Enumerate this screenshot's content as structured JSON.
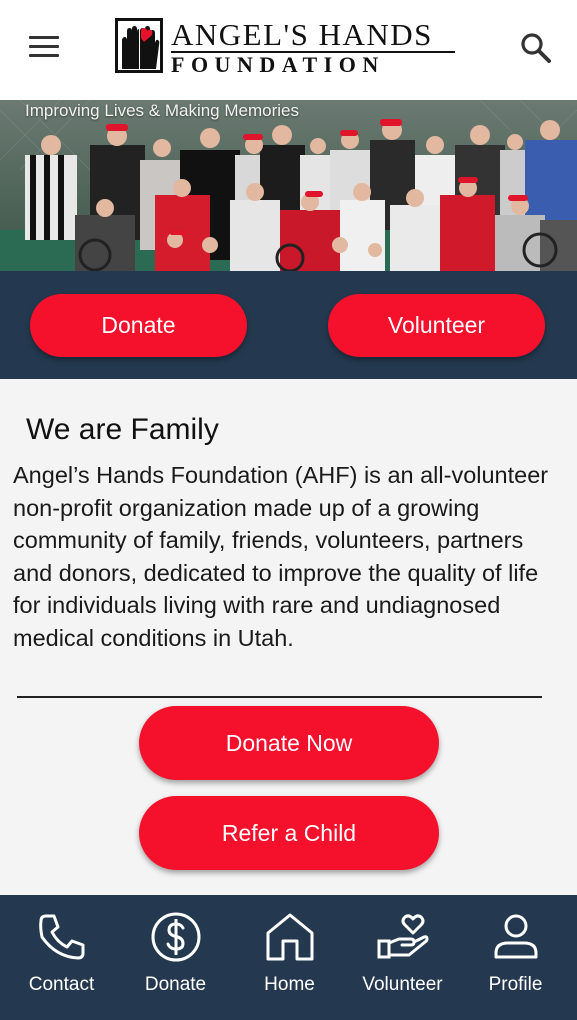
{
  "header": {
    "logo_line1": "ANGEL'S HANDS",
    "logo_line2": "FOUNDATION",
    "menu_icon": "hamburger-menu-icon",
    "search_icon": "search-icon"
  },
  "hero": {
    "tagline": "Improving Lives & Making Memories"
  },
  "cta": {
    "donate_label": "Donate",
    "volunteer_label": "Volunteer"
  },
  "content": {
    "title": "We are Family",
    "paragraph": "Angel’s Hands Foundation (AHF) is an all-volunteer non-profit organization made up of a growing community of family, friends, volunteers, partners and donors, dedicated to improve the quality of life for individuals living with rare and undiagnosed medical conditions in Utah.",
    "donate_now_label": "Donate Now",
    "refer_label": "Refer a Child"
  },
  "tabbar": {
    "items": [
      {
        "label": "Contact",
        "icon": "phone-icon"
      },
      {
        "label": "Donate",
        "icon": "dollar-circle-icon"
      },
      {
        "label": "Home",
        "icon": "home-icon"
      },
      {
        "label": "Volunteer",
        "icon": "hand-heart-icon"
      },
      {
        "label": "Profile",
        "icon": "person-icon"
      }
    ]
  },
  "colors": {
    "accent_red": "#f5102c",
    "navy": "#24394f",
    "background": "#f4f4f4"
  }
}
